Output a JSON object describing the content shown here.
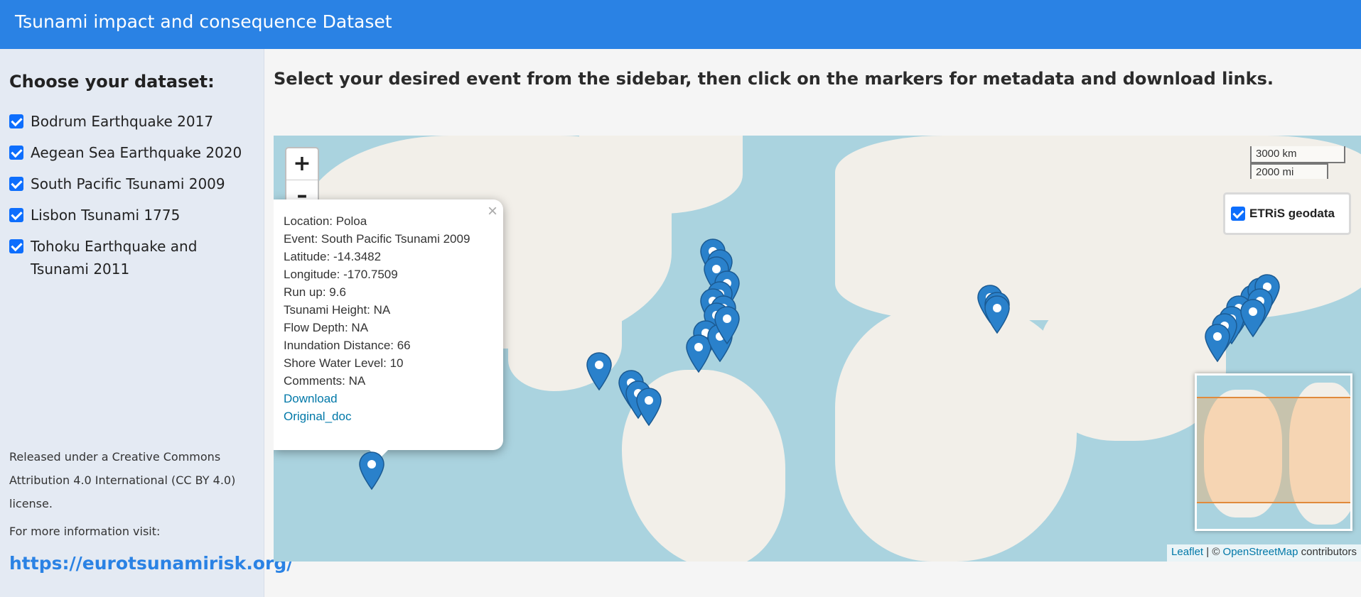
{
  "app": {
    "title": "Tsunami impact and consequence Dataset"
  },
  "sidebar": {
    "heading": "Choose your dataset:",
    "datasets": [
      {
        "label": "Bodrum Earthquake 2017",
        "checked": true
      },
      {
        "label": "Aegean Sea Earthquake 2020",
        "checked": true
      },
      {
        "label": "South Pacific Tsunami 2009",
        "checked": true
      },
      {
        "label": "Lisbon Tsunami 1775",
        "checked": true
      },
      {
        "label": "Tohoku Earthquake and Tsunami 2011",
        "checked": true
      }
    ],
    "license_text": "Released under a Creative Commons Attribution 4.0 International (CC BY 4.0) license.",
    "more_info": "For more information visit:",
    "link_text": "https://eurotsunamirisk.org/"
  },
  "main": {
    "headline": "Select your desired event from the sidebar, then click on the markers for metadata and download links."
  },
  "map": {
    "zoom_in": "+",
    "zoom_out": "–",
    "scale_km": "3000 km",
    "scale_mi": "2000 mi",
    "layer_label": "ETRiS geodata",
    "popup": {
      "close": "×",
      "lines": [
        "Location: Poloa",
        "Event: South Pacific Tsunami 2009",
        "Latitude: -14.3482",
        "Longitude: -170.7509",
        "Run up: 9.6",
        "Tsunami Height: NA",
        "Flow Depth: NA",
        "Inundation Distance: 66",
        "Shore Water Level: 10",
        "Comments: NA"
      ],
      "download": "Download",
      "original_doc": "Original_doc"
    },
    "attribution": {
      "leaflet": "Leaflet",
      "sep": " | © ",
      "osm": "OpenStreetMap",
      "suffix": " contributors"
    },
    "marker_color": "#2a81cb"
  }
}
